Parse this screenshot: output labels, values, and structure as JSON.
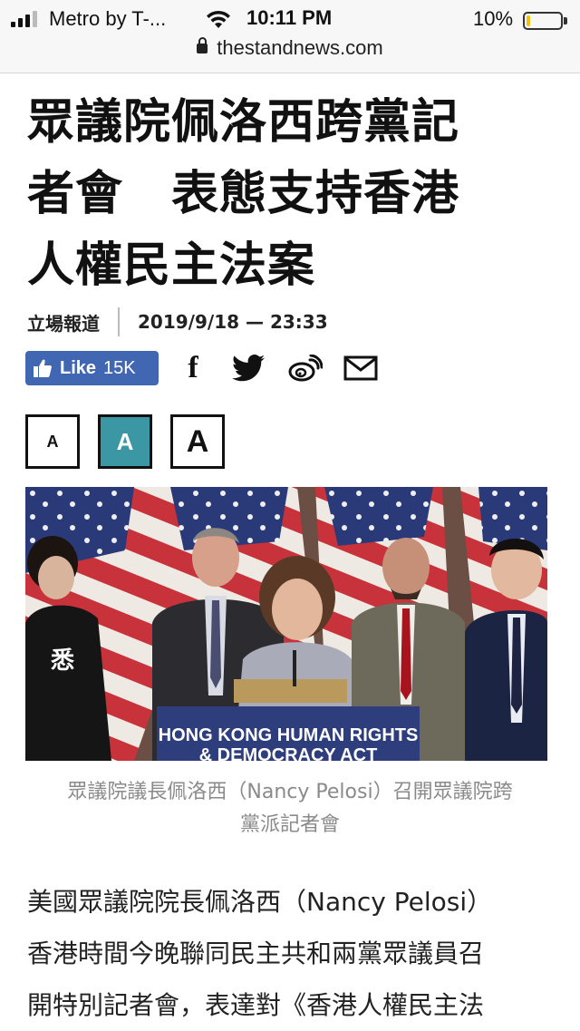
{
  "status_bar": {
    "carrier": "Metro by T-...",
    "time": "10:11 PM",
    "battery_percent": "10%",
    "battery_level": 0.1,
    "battery_color": "#f4c20d"
  },
  "address_bar": {
    "url": "thestandnews.com",
    "lock_icon": "lock-icon"
  },
  "article": {
    "headline_lines": [
      "眾議院佩洛西跨黨記",
      "者會　表態支持香港",
      "人權民主法案"
    ],
    "source": "立場報道",
    "datetime": "2019/9/18 — 23:33",
    "like_button": {
      "label": "Like",
      "count": "15K",
      "color": "#4267b2"
    },
    "share_icons": [
      "facebook-icon",
      "twitter-icon",
      "weibo-icon",
      "mail-icon"
    ],
    "font_size_buttons": [
      {
        "label": "A",
        "active": false
      },
      {
        "label": "A",
        "active": true,
        "color": "#3a97a3"
      },
      {
        "label": "A",
        "active": false
      }
    ],
    "photo": {
      "podium_sign_line1": "HONG KONG HUMAN RIGHTS",
      "podium_sign_line2": "& DEMOCRACY ACT"
    },
    "caption_lines": [
      "眾議院議長佩洛西（Nancy Pelosi）召開眾議院跨",
      "黨派記者會"
    ],
    "body_lines": [
      "美國眾議院院長佩洛西（Nancy Pelosi）",
      "香港時間今晚聯同民主共和兩黨眾議員召",
      "開特別記者會，表達對《香港人權民主法"
    ]
  }
}
